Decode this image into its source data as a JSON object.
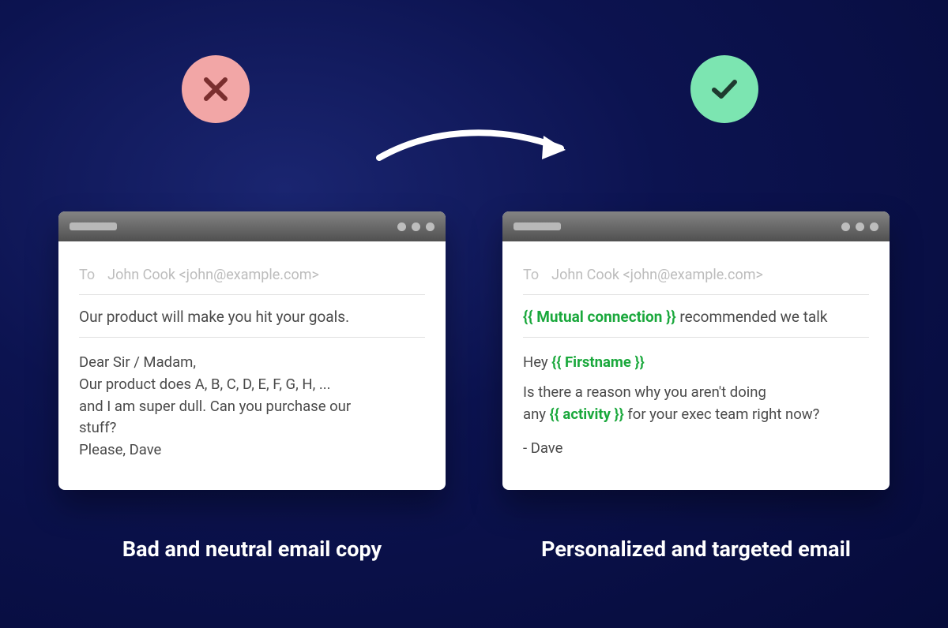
{
  "badges": {
    "bad": "cross",
    "good": "check"
  },
  "left": {
    "to_label": "To",
    "to_value": "John Cook <john@example.com>",
    "subject": "Our product will make you hit your goals.",
    "body_lines": [
      "Dear Sir / Madam,",
      "Our product does A, B, C, D, E, F, G, H, ...",
      "and I am super dull. Can you purchase our",
      "stuff?",
      "Please, Dave"
    ],
    "caption": "Bad and neutral email copy"
  },
  "right": {
    "to_label": "To",
    "to_value": "John Cook <john@example.com>",
    "subject_token": "{{ Mutual connection }}",
    "subject_rest": " recommended we talk",
    "body_prefix": "Hey ",
    "body_token1": "{{ Firstname }}",
    "body_line2": "Is there a reason why you aren't doing",
    "body_line3_pre": "any ",
    "body_token2": "{{ activity }}",
    "body_line3_post": " for your exec team right now?",
    "body_signoff": "- Dave",
    "caption": "Personalized and targeted email"
  }
}
